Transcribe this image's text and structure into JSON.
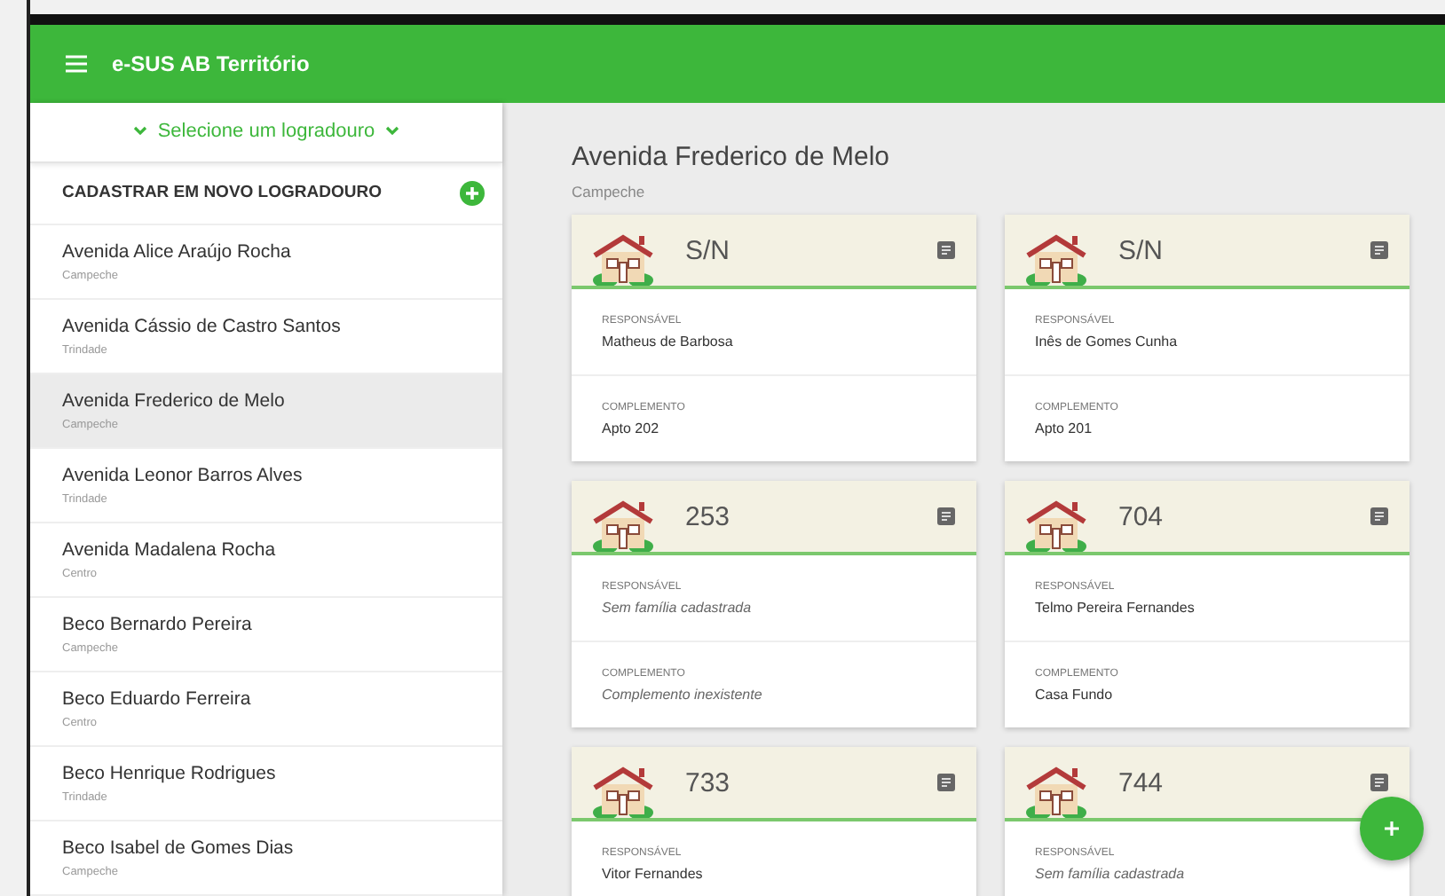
{
  "app_bar": {
    "title": "e-SUS AB Território"
  },
  "sidebar": {
    "selector": "Selecione um logradouro",
    "add_label": "CADASTRAR EM NOVO LOGRADOURO",
    "items": [
      {
        "name": "Avenida Alice Araújo Rocha",
        "district": "Campeche",
        "selected": false
      },
      {
        "name": "Avenida Cássio de Castro Santos",
        "district": "Trindade",
        "selected": false
      },
      {
        "name": "Avenida Frederico de Melo",
        "district": "Campeche",
        "selected": true
      },
      {
        "name": "Avenida Leonor Barros Alves",
        "district": "Trindade",
        "selected": false
      },
      {
        "name": "Avenida Madalena Rocha",
        "district": "Centro",
        "selected": false
      },
      {
        "name": "Beco Bernardo Pereira",
        "district": "Campeche",
        "selected": false
      },
      {
        "name": "Beco Eduardo Ferreira",
        "district": "Centro",
        "selected": false
      },
      {
        "name": "Beco Henrique Rodrigues",
        "district": "Trindade",
        "selected": false
      },
      {
        "name": "Beco Isabel de Gomes Dias",
        "district": "Campeche",
        "selected": false
      }
    ]
  },
  "main": {
    "title": "Avenida Frederico de Melo",
    "subtitle": "Campeche",
    "cards": [
      {
        "number": "S/N",
        "fields": [
          {
            "label": "RESPONSÁVEL",
            "value": "Matheus de Barbosa",
            "missing": false
          },
          {
            "label": "COMPLEMENTO",
            "value": "Apto 202",
            "missing": false
          }
        ]
      },
      {
        "number": "S/N",
        "fields": [
          {
            "label": "RESPONSÁVEL",
            "value": "Inês de Gomes Cunha",
            "missing": false
          },
          {
            "label": "COMPLEMENTO",
            "value": "Apto 201",
            "missing": false
          }
        ]
      },
      {
        "number": "253",
        "fields": [
          {
            "label": "RESPONSÁVEL",
            "value": "Sem família cadastrada",
            "missing": true
          },
          {
            "label": "COMPLEMENTO",
            "value": "Complemento inexistente",
            "missing": true
          }
        ]
      },
      {
        "number": "704",
        "fields": [
          {
            "label": "RESPONSÁVEL",
            "value": "Telmo Pereira Fernandes",
            "missing": false
          },
          {
            "label": "COMPLEMENTO",
            "value": "Casa Fundo",
            "missing": false
          }
        ]
      },
      {
        "number": "733",
        "fields": [
          {
            "label": "RESPONSÁVEL",
            "value": "Vitor Fernandes",
            "missing": false
          }
        ]
      },
      {
        "number": "744",
        "fields": [
          {
            "label": "RESPONSÁVEL",
            "value": "Sem família cadastrada",
            "missing": true
          }
        ]
      }
    ]
  }
}
